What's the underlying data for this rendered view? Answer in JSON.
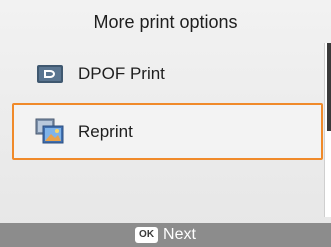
{
  "screen": {
    "title": "More print options"
  },
  "menu": {
    "items": [
      {
        "label": "DPOF Print",
        "icon": "dpof-print-icon"
      },
      {
        "label": "Reprint",
        "icon": "reprint-photos-icon",
        "selected": true
      }
    ]
  },
  "footer": {
    "button_badge": "OK",
    "action_label": "Next"
  },
  "colors": {
    "selection_border": "#f08a2a",
    "footer_bar": "#8c8c8c"
  }
}
